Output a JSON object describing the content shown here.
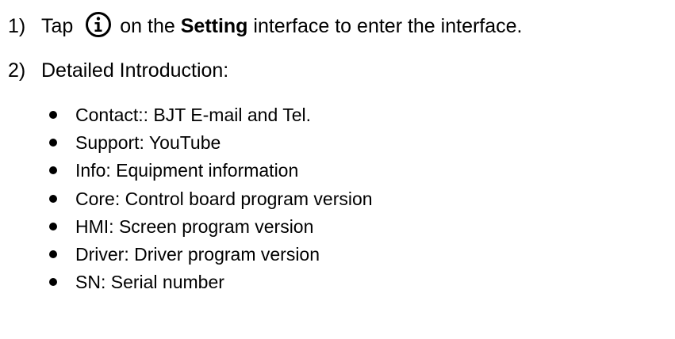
{
  "steps": [
    {
      "number": "1)",
      "before_icon": "Tap",
      "icon": "info-circle-icon",
      "middle": "on the",
      "emphasis": "Setting",
      "after": "interface to enter the interface."
    },
    {
      "number": "2)",
      "text": "Detailed Introduction:"
    }
  ],
  "details": [
    "Contact:: BJT E-mail and Tel.",
    "Support: YouTube",
    "Info: Equipment information",
    "Core: Control board program version",
    "HMI: Screen program version",
    "Driver: Driver program version",
    "SN: Serial number"
  ]
}
